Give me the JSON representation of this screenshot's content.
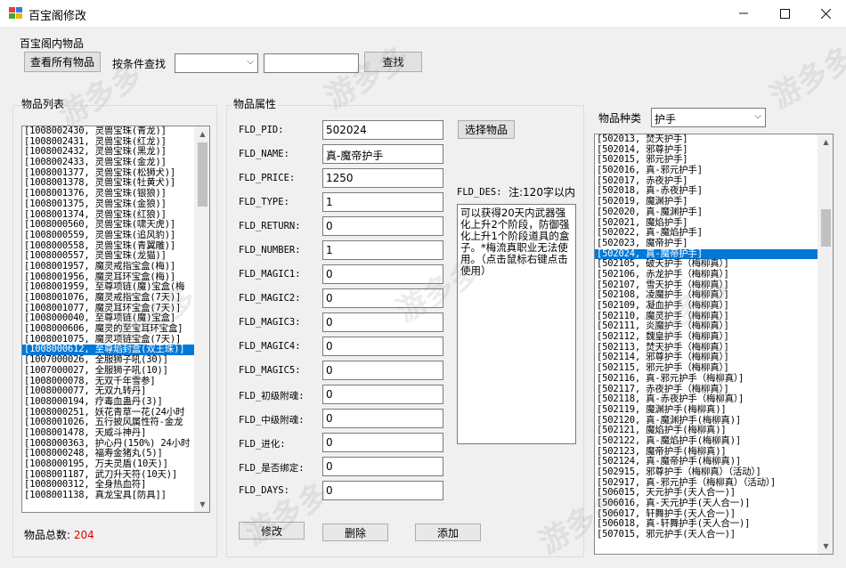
{
  "window": {
    "title": "百宝阁修改"
  },
  "toolbar": {
    "section_title": "百宝阁内物品",
    "view_all_label": "查看所有物品",
    "search_by_label": "按条件查找",
    "condition_value": "",
    "search_text": "",
    "search_label": "查找"
  },
  "item_list": {
    "title": "物品列表",
    "items": [
      "[1008002430, 灵兽宝珠(青龙)]",
      "[1008002431, 灵兽宝珠(红龙)]",
      "[1008002432, 灵兽宝珠(黑龙)]",
      "[1008002433, 灵兽宝珠(金龙)]",
      "[1008001377, 灵兽宝珠(松狮犬)]",
      "[1008001378, 灵兽宝珠(牡黄犬)]",
      "[1008001376, 灵兽宝珠(银狼)]",
      "[1008001375, 灵兽宝珠(金狼)]",
      "[1008001374, 灵兽宝珠(红狼)]",
      "[1008000560, 灵兽宝珠(啸天虎)]",
      "[1008000559, 灵兽宝珠(追风豹)]",
      "[1008000558, 灵兽宝珠(青翼雕)]",
      "[1008000557, 灵兽宝珠(龙猫)]",
      "[1008001957, 魔灵戒指宝盒(梅)]",
      "[1008001956, 魔灵耳环宝盒(梅)]",
      "[1008001959, 至尊项链(魔)宝盒(梅",
      "[1008001076, 魔灵戒指宝盒(7天)]",
      "[1008001077, 魔灵耳环宝盒(7天)]",
      "[1008000040, 至尊项链(魔)宝盒]",
      "[1008000606, 魔灵的至宝耳环宝盒]",
      "[1008001075, 魔灵项链宝盒(7天)]",
      "[1008000612, 至尊焰封盒(双王珠)]",
      "[1007000026, 全服狮子吼(30)]",
      "[1007000027, 全服狮子吼(10)]",
      "[1008000078, 无双千年雪参]",
      "[1008000077, 无双九转丹]",
      "[1008000194, 疗毒血蛊丹(3)]",
      "[1008000251, 妖花青草一花(24小时",
      "[1008001026, 五行披风属性符-金龙",
      "[1008001478, 天威斗神丹]",
      "[1008000363, 护心丹(150%) 24小时",
      "[1008000248, 福寿金猪丸(5)]",
      "[1008000195, 万夫灵盾(10天)]",
      "[1008001187, 武刀升天符(10天)]",
      "[1008000312, 全身热血符]",
      "[1008001138, 真龙宝具[防具]]"
    ],
    "selected_index": 21,
    "total_label": "物品总数:",
    "total_value": "204"
  },
  "attributes": {
    "title": "物品属性",
    "select_item_label": "选择物品",
    "des_label": "FLD_DES:",
    "des_note": "注:120字以内",
    "description": "可以获得20天内武器强化上升2个阶段，防御强化上升1个阶段道具的盒子。*梅流真职业无法使用。（点击鼠标右键点击使用）",
    "fields": [
      {
        "label": "FLD_PID:",
        "value": "502024"
      },
      {
        "label": "FLD_NAME:",
        "value": "真-魔帝护手"
      },
      {
        "label": "FLD_PRICE:",
        "value": "1250"
      },
      {
        "label": "FLD_TYPE:",
        "value": "1"
      },
      {
        "label": "FLD_RETURN:",
        "value": "0"
      },
      {
        "label": "FLD_NUMBER:",
        "value": "1"
      },
      {
        "label": "FLD_MAGIC1:",
        "value": "0"
      },
      {
        "label": "FLD_MAGIC2:",
        "value": "0"
      },
      {
        "label": "FLD_MAGIC3:",
        "value": "0"
      },
      {
        "label": "FLD_MAGIC4:",
        "value": "0"
      },
      {
        "label": "FLD_MAGIC5:",
        "value": "0"
      },
      {
        "label": "FLD_初级附魂:",
        "value": "0"
      },
      {
        "label": "FLD_中级附魂:",
        "value": "0"
      },
      {
        "label": "FLD_进化:",
        "value": "0"
      },
      {
        "label": "FLD_是否绑定:",
        "value": "0"
      },
      {
        "label": "FLD_DAYS:",
        "value": "0"
      }
    ],
    "modify_label": "修改",
    "delete_label": "删除",
    "add_label": "添加"
  },
  "category": {
    "label": "物品种类",
    "selected": "护手",
    "items": [
      "[502013, 焚天护手]",
      "[502014, 邪尊护手]",
      "[502015, 邪元护手]",
      "[502016, 真-邪元护手]",
      "[502017, 赤夜护手]",
      "[502018, 真-赤夜护手]",
      "[502019, 魔渊护手]",
      "[502020, 真-魔渊护手]",
      "[502021, 魔焰护手]",
      "[502022, 真-魔焰护手]",
      "[502023, 魔帝护手]",
      "[502024, 真-魔帝护手]",
      "[502105, 破天护手（梅柳真）]",
      "[502106, 赤龙护手（梅柳真）]",
      "[502107, 雪天护手（梅柳真）]",
      "[502108, 凌魔护手（梅柳真）]",
      "[502109, 凝血护手（梅柳真）]",
      "[502110, 魔灵护手（梅柳真）]",
      "[502111, 炎魔护手（梅柳真）]",
      "[502112, 魏皇护手（梅柳真）]",
      "[502113, 焚天护手（梅柳真）]",
      "[502114, 邪尊护手（梅柳真）]",
      "[502115, 邪元护手（梅柳真）]",
      "[502116, 真-邪元护手（梅柳真）]",
      "[502117, 赤夜护手（梅柳真）]",
      "[502118, 真-赤夜护手（梅柳真）]",
      "[502119, 魔渊护手(梅柳真)]",
      "[502120, 真-魔渊护手(梅柳真)]",
      "[502121, 魔焰护手(梅柳真)]",
      "[502122, 真-魔焰护手(梅柳真)]",
      "[502123, 魔帝护手(梅柳真)]",
      "[502124, 真-魔帝护手(梅柳真)]",
      "[502915, 邪尊护手（梅柳真）（活动）]",
      "[502917, 真-邪元护手（梅柳真）（活动）]",
      "[506015, 天元护手(天人合一)]",
      "[506016, 真-天元护手(天人合一)]",
      "[506017, 轩舞护手(天人合一)]",
      "[506018, 真-轩舞护手(天人合一)]",
      "[507015, 邪元护手(天人合一)]"
    ],
    "selected_index": 11
  },
  "watermark": {
    "brand": "游多多",
    "sub": "Youdd.Net"
  },
  "colors": {
    "selection": "#0078d7",
    "total_value": "#e00000"
  }
}
